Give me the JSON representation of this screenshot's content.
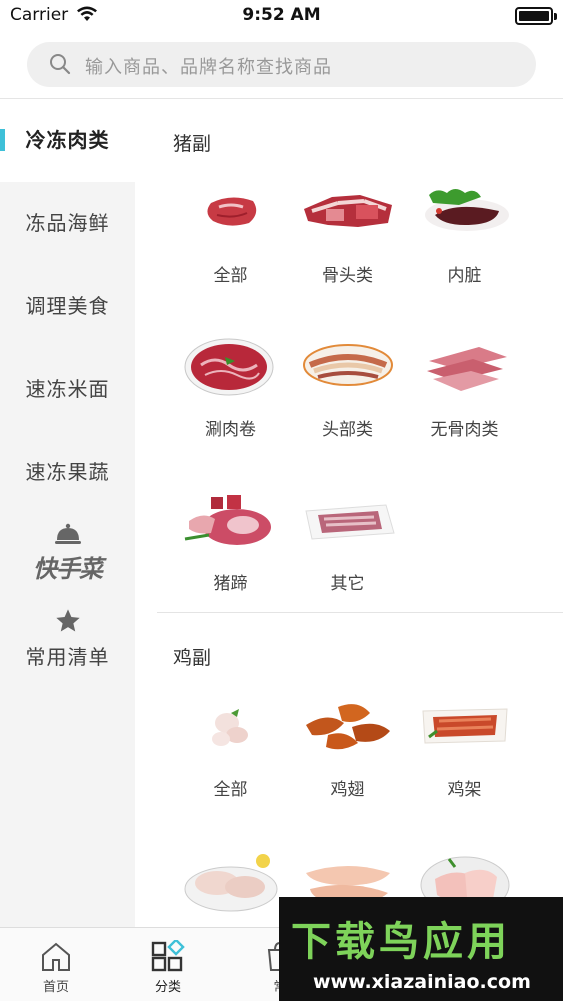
{
  "status": {
    "carrier": "Carrier",
    "time": "9:52 AM",
    "battery": 1.0
  },
  "search": {
    "placeholder": "输入商品、品牌名称查找商品"
  },
  "sidebar": {
    "items": [
      {
        "label": "冷冻肉类",
        "active": true
      },
      {
        "label": "冻品海鲜"
      },
      {
        "label": "调理美食"
      },
      {
        "label": "速冻米面"
      },
      {
        "label": "速冻果蔬"
      }
    ],
    "kuai_label": "快手菜",
    "changyong_label": "常用清单"
  },
  "sections": [
    {
      "title": "猪副",
      "items": [
        {
          "label": "全部"
        },
        {
          "label": "骨头类"
        },
        {
          "label": "内脏"
        },
        {
          "label": "涮肉卷"
        },
        {
          "label": "头部类"
        },
        {
          "label": "无骨肉类"
        },
        {
          "label": "猪蹄"
        },
        {
          "label": "其它"
        }
      ]
    },
    {
      "title": "鸡副",
      "items": [
        {
          "label": "全部"
        },
        {
          "label": "鸡翅"
        },
        {
          "label": "鸡架"
        }
      ]
    }
  ],
  "tabbar": [
    {
      "label": "首页",
      "icon": "home-icon"
    },
    {
      "label": "分类",
      "icon": "category-icon",
      "active": true
    },
    {
      "label": "常",
      "icon": "bag-icon"
    }
  ],
  "watermark": {
    "title": "下载鸟应用",
    "url": "www.xiazainiao.com"
  },
  "colors": {
    "accent": "#3ec0d8",
    "sidebar_bg": "#f4f4f4"
  }
}
